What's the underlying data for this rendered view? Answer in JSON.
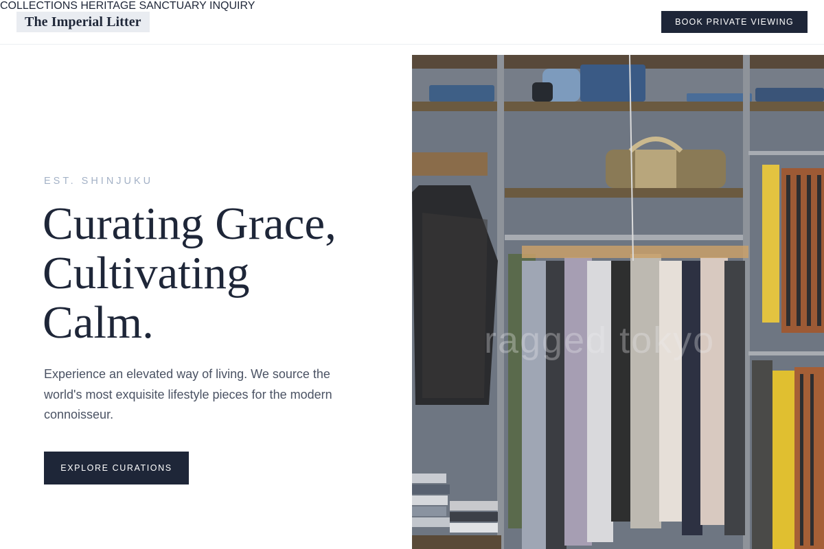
{
  "brand": {
    "name": "The Imperial Litter"
  },
  "nav": {
    "items": [
      {
        "label": "COLLECTIONS"
      },
      {
        "label": "HERITAGE"
      },
      {
        "label": "SANCTUARY"
      },
      {
        "label": "INQUIRY"
      }
    ],
    "cta_label": "BOOK PRIVATE VIEWING"
  },
  "hero": {
    "eyebrow": "EST. SHINJUKU",
    "headline_lines": [
      "Curating Grace,",
      "Cultivating",
      "Calm."
    ],
    "lead": "Experience an elevated way of living. We source the world's most exquisite lifestyle pieces for the modern connoisseur.",
    "cta_label": "EXPLORE CURATIONS",
    "image": {
      "subject": "wardrobe-with-hanging-clothes",
      "watermark": "ragged tokyo"
    }
  },
  "colors": {
    "primary": "#1e2638",
    "eyebrow": "#a3b1c6",
    "body_text": "#4a5263",
    "logo_bg": "#e9ecf1"
  }
}
